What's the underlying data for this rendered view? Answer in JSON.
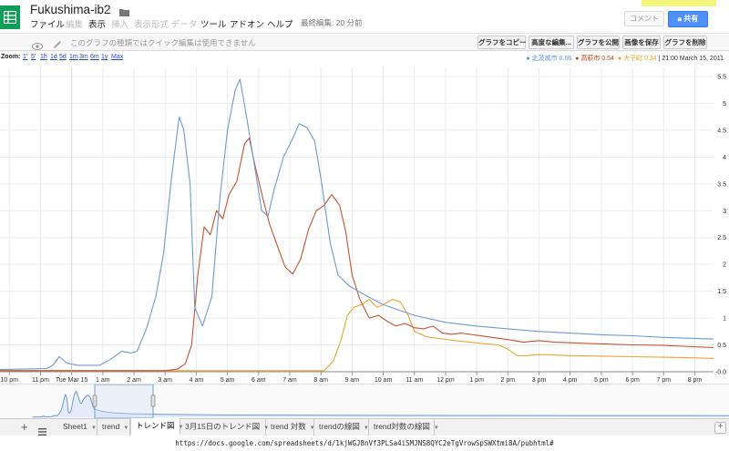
{
  "header": {
    "title": "Fukushima-ib2",
    "last_edit": "最終編集: 20 分前",
    "comment_label": "コメント",
    "share_label": "共有",
    "menu": [
      {
        "label": "ファイル",
        "enabled": true
      },
      {
        "label": "編集",
        "enabled": false
      },
      {
        "label": "表示",
        "enabled": true
      },
      {
        "label": "挿入",
        "enabled": false
      },
      {
        "label": "表示形式",
        "enabled": false
      },
      {
        "label": "データ",
        "enabled": false
      },
      {
        "label": "ツール",
        "enabled": true
      },
      {
        "label": "アドオン",
        "enabled": true
      },
      {
        "label": "ヘルプ",
        "enabled": true
      }
    ]
  },
  "toolbar": {
    "notice": "このグラフの種類ではクイック編集は使用できません",
    "buttons": [
      "グラフをコピー",
      "高度な編集...",
      "グラフを公開",
      "画像を保存",
      "グラフを削除"
    ]
  },
  "zoom": {
    "label": "Zoom:",
    "options": [
      "1'",
      "5'",
      "1h",
      "1d",
      "5d",
      "1m",
      "3m",
      "6m",
      "1y",
      "Max"
    ]
  },
  "legend": {
    "timestamp": "21:00 March 15, 2011",
    "entries": [
      {
        "name": "北茨城市",
        "value": "0.66",
        "color": "#5b8fce"
      },
      {
        "name": "高萩市",
        "value": "0.54",
        "color": "#c6421c"
      },
      {
        "name": "大子町",
        "value": "0.34",
        "color": "#e8a31b"
      }
    ]
  },
  "chart_data": {
    "type": "line",
    "x_tick_labels": [
      "10 pm",
      "11 pm",
      "Tue Mar 15",
      "1 am",
      "2 am",
      "3 am",
      "4 am",
      "5 am",
      "6 am",
      "7 am",
      "8 am",
      "9 am",
      "10 am",
      "11 am",
      "12 pm",
      "1 pm",
      "2 pm",
      "3 pm",
      "4 pm",
      "5 pm",
      "6 pm",
      "7 pm",
      "8 pm"
    ],
    "y_tick_labels": [
      "5.5",
      "5",
      "4.5",
      "4",
      "3.5",
      "3",
      "2.5",
      "2",
      "1.5",
      "1",
      "0.5",
      "-0.0"
    ],
    "ylim": [
      0,
      5.5
    ],
    "x_range_hours": [
      -2.3,
      20.6
    ],
    "x_unit": "hours relative to 00:00 Tue Mar 15, 2011",
    "series": [
      {
        "name": "北茨城市",
        "color": "#6e9ad4",
        "points": [
          [
            -2.3,
            0.04
          ],
          [
            -0.8,
            0.06
          ],
          [
            -0.6,
            0.12
          ],
          [
            -0.4,
            0.28
          ],
          [
            -0.15,
            0.16
          ],
          [
            0.2,
            0.12
          ],
          [
            0.9,
            0.12
          ],
          [
            1.3,
            0.25
          ],
          [
            1.6,
            0.38
          ],
          [
            1.9,
            0.35
          ],
          [
            2.1,
            0.38
          ],
          [
            2.4,
            0.8
          ],
          [
            2.7,
            1.4
          ],
          [
            2.95,
            2.2
          ],
          [
            3.2,
            3.6
          ],
          [
            3.45,
            4.75
          ],
          [
            3.6,
            4.5
          ],
          [
            3.8,
            3.5
          ],
          [
            3.95,
            1.2
          ],
          [
            4.2,
            0.85
          ],
          [
            4.5,
            1.4
          ],
          [
            4.75,
            3.2
          ],
          [
            5.0,
            4.5
          ],
          [
            5.25,
            5.25
          ],
          [
            5.4,
            5.45
          ],
          [
            5.6,
            4.8
          ],
          [
            5.85,
            3.9
          ],
          [
            6.1,
            3.0
          ],
          [
            6.3,
            2.9
          ],
          [
            6.5,
            3.4
          ],
          [
            6.8,
            4.0
          ],
          [
            7.1,
            4.35
          ],
          [
            7.3,
            4.62
          ],
          [
            7.55,
            4.55
          ],
          [
            7.8,
            4.3
          ],
          [
            8.0,
            3.6
          ],
          [
            8.3,
            2.4
          ],
          [
            8.55,
            1.8
          ],
          [
            8.9,
            1.6
          ],
          [
            9.5,
            1.4
          ],
          [
            10.0,
            1.25
          ],
          [
            11.0,
            1.05
          ],
          [
            12.0,
            0.92
          ],
          [
            13.0,
            0.85
          ],
          [
            14.0,
            0.8
          ],
          [
            15.0,
            0.75
          ],
          [
            16.0,
            0.72
          ],
          [
            17.0,
            0.69
          ],
          [
            18.0,
            0.67
          ],
          [
            19.0,
            0.64
          ],
          [
            20.6,
            0.61
          ]
        ]
      },
      {
        "name": "高萩市",
        "color": "#c8532f",
        "points": [
          [
            -2.3,
            0.02
          ],
          [
            3.0,
            0.02
          ],
          [
            3.4,
            0.05
          ],
          [
            3.65,
            0.15
          ],
          [
            3.85,
            0.5
          ],
          [
            4.05,
            1.8
          ],
          [
            4.25,
            2.7
          ],
          [
            4.45,
            2.55
          ],
          [
            4.65,
            3.0
          ],
          [
            4.85,
            2.85
          ],
          [
            5.05,
            3.3
          ],
          [
            5.3,
            3.55
          ],
          [
            5.55,
            4.25
          ],
          [
            5.7,
            4.35
          ],
          [
            5.9,
            3.8
          ],
          [
            6.15,
            3.2
          ],
          [
            6.35,
            2.75
          ],
          [
            6.6,
            2.35
          ],
          [
            6.85,
            1.95
          ],
          [
            7.1,
            1.82
          ],
          [
            7.35,
            2.1
          ],
          [
            7.6,
            2.65
          ],
          [
            7.85,
            3.0
          ],
          [
            8.1,
            3.1
          ],
          [
            8.35,
            3.3
          ],
          [
            8.6,
            3.1
          ],
          [
            8.8,
            2.6
          ],
          [
            9.0,
            1.8
          ],
          [
            9.25,
            1.35
          ],
          [
            9.55,
            1.0
          ],
          [
            9.85,
            1.05
          ],
          [
            10.1,
            0.95
          ],
          [
            10.4,
            0.85
          ],
          [
            10.7,
            0.9
          ],
          [
            11.0,
            0.82
          ],
          [
            11.3,
            0.8
          ],
          [
            11.6,
            0.85
          ],
          [
            11.9,
            0.72
          ],
          [
            12.2,
            0.7
          ],
          [
            12.5,
            0.72
          ],
          [
            13.0,
            0.68
          ],
          [
            14.0,
            0.6
          ],
          [
            14.5,
            0.55
          ],
          [
            15.0,
            0.58
          ],
          [
            15.5,
            0.55
          ],
          [
            16.0,
            0.54
          ],
          [
            17.0,
            0.52
          ],
          [
            18.0,
            0.5
          ],
          [
            19.0,
            0.49
          ],
          [
            20.6,
            0.45
          ]
        ]
      },
      {
        "name": "大子町",
        "color": "#e8a630",
        "points": [
          [
            -2.3,
            0.02
          ],
          [
            8.1,
            0.02
          ],
          [
            8.4,
            0.2
          ],
          [
            8.65,
            0.6
          ],
          [
            8.85,
            1.05
          ],
          [
            9.05,
            1.2
          ],
          [
            9.3,
            1.25
          ],
          [
            9.55,
            1.35
          ],
          [
            9.8,
            1.2
          ],
          [
            10.0,
            1.25
          ],
          [
            10.3,
            1.35
          ],
          [
            10.55,
            1.3
          ],
          [
            10.8,
            1.05
          ],
          [
            11.0,
            0.75
          ],
          [
            11.4,
            0.65
          ],
          [
            11.8,
            0.62
          ],
          [
            12.3,
            0.58
          ],
          [
            12.8,
            0.55
          ],
          [
            13.3,
            0.52
          ],
          [
            13.7,
            0.5
          ],
          [
            14.0,
            0.42
          ],
          [
            14.3,
            0.3
          ],
          [
            14.6,
            0.3
          ],
          [
            15.0,
            0.32
          ],
          [
            16.0,
            0.3
          ],
          [
            17.0,
            0.29
          ],
          [
            18.0,
            0.28
          ],
          [
            19.0,
            0.27
          ],
          [
            20.6,
            0.25
          ]
        ]
      }
    ]
  },
  "tabs": [
    {
      "label": "Sheet1",
      "active": false
    },
    {
      "label": "trend",
      "active": false
    },
    {
      "label": "トレンド図",
      "active": true
    },
    {
      "label": "3月15日のトレンド図",
      "active": false
    },
    {
      "label": "trend 対数",
      "active": false
    },
    {
      "label": "trendの線図",
      "active": false
    },
    {
      "label": "trend対数の線図",
      "active": false
    }
  ],
  "url": "https://docs.google.com/spreadsheets/d/1kjWGJ8nVf3PLSa4iSMJNS8QYC2eTgVrowSpSWXtmi8A/pubhtml#"
}
